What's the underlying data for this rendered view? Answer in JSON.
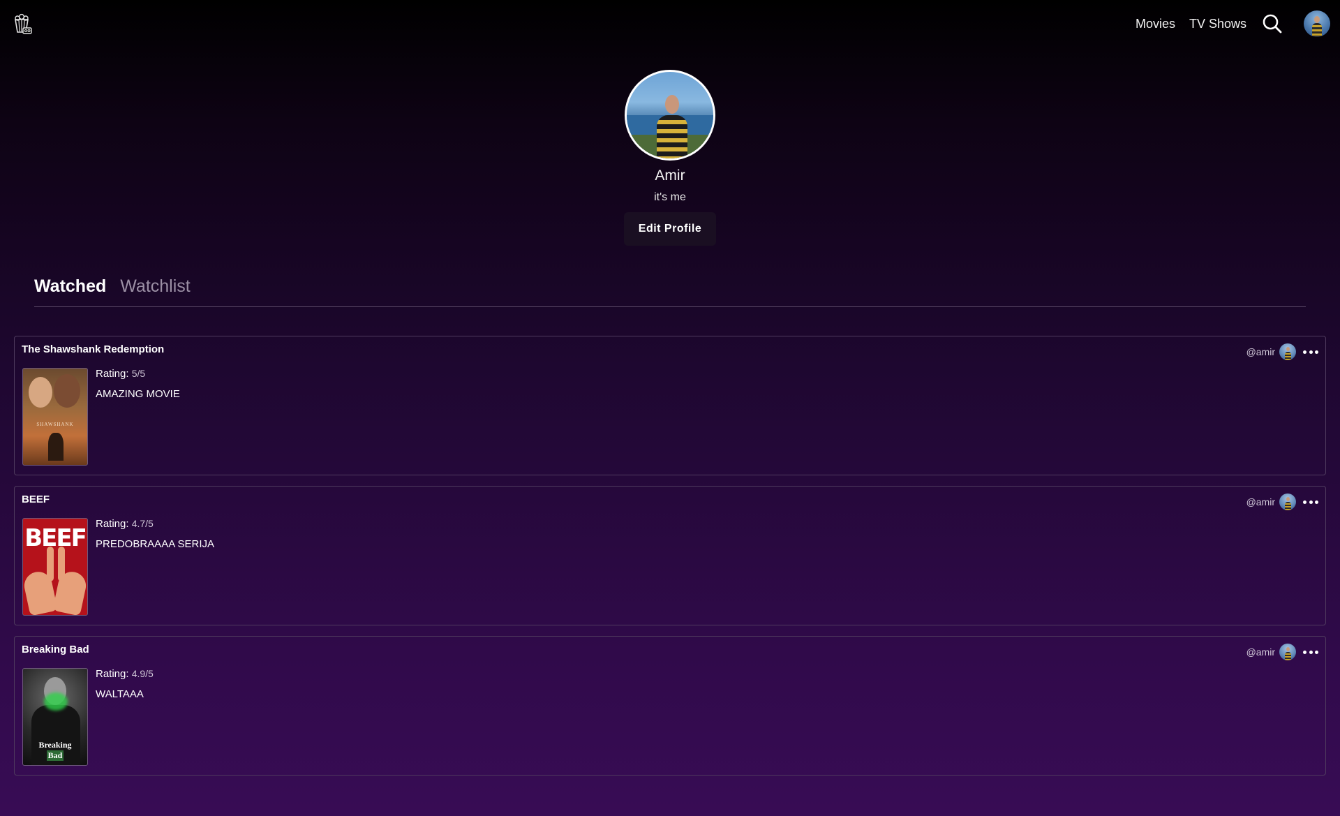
{
  "nav": {
    "logo_icon": "popcorn-icon",
    "movies_label": "Movies",
    "tvshows_label": "TV Shows",
    "search_icon": "search-icon",
    "avatar_icon": "user-avatar"
  },
  "profile": {
    "name": "Amir",
    "bio": "it's me",
    "edit_label": "Edit Profile"
  },
  "tabs": [
    {
      "label": "Watched",
      "active": true
    },
    {
      "label": "Watchlist",
      "active": false
    }
  ],
  "reviews": [
    {
      "title": "The Shawshank Redemption",
      "rating_label": "Rating:",
      "rating_value": "5/5",
      "text": "AMAZING MOVIE",
      "handle": "@amir",
      "poster_text": "SHAWSHANK"
    },
    {
      "title": "BEEF",
      "rating_label": "Rating:",
      "rating_value": "4.7/5",
      "text": "PREDOBRAAAA SERIJA",
      "handle": "@amir",
      "poster_text": "BEEF"
    },
    {
      "title": "Breaking Bad",
      "rating_label": "Rating:",
      "rating_value": "4.9/5",
      "text": "WALTAAA",
      "handle": "@amir",
      "poster_text_line1": "Breaking",
      "poster_text_line2": "Bad"
    }
  ],
  "colors": {
    "background_top": "#000000",
    "background_bottom": "#380c55",
    "card_border": "#4f3b5e",
    "tab_inactive": "#9b8fa4",
    "button_bg": "#1a0f22"
  }
}
